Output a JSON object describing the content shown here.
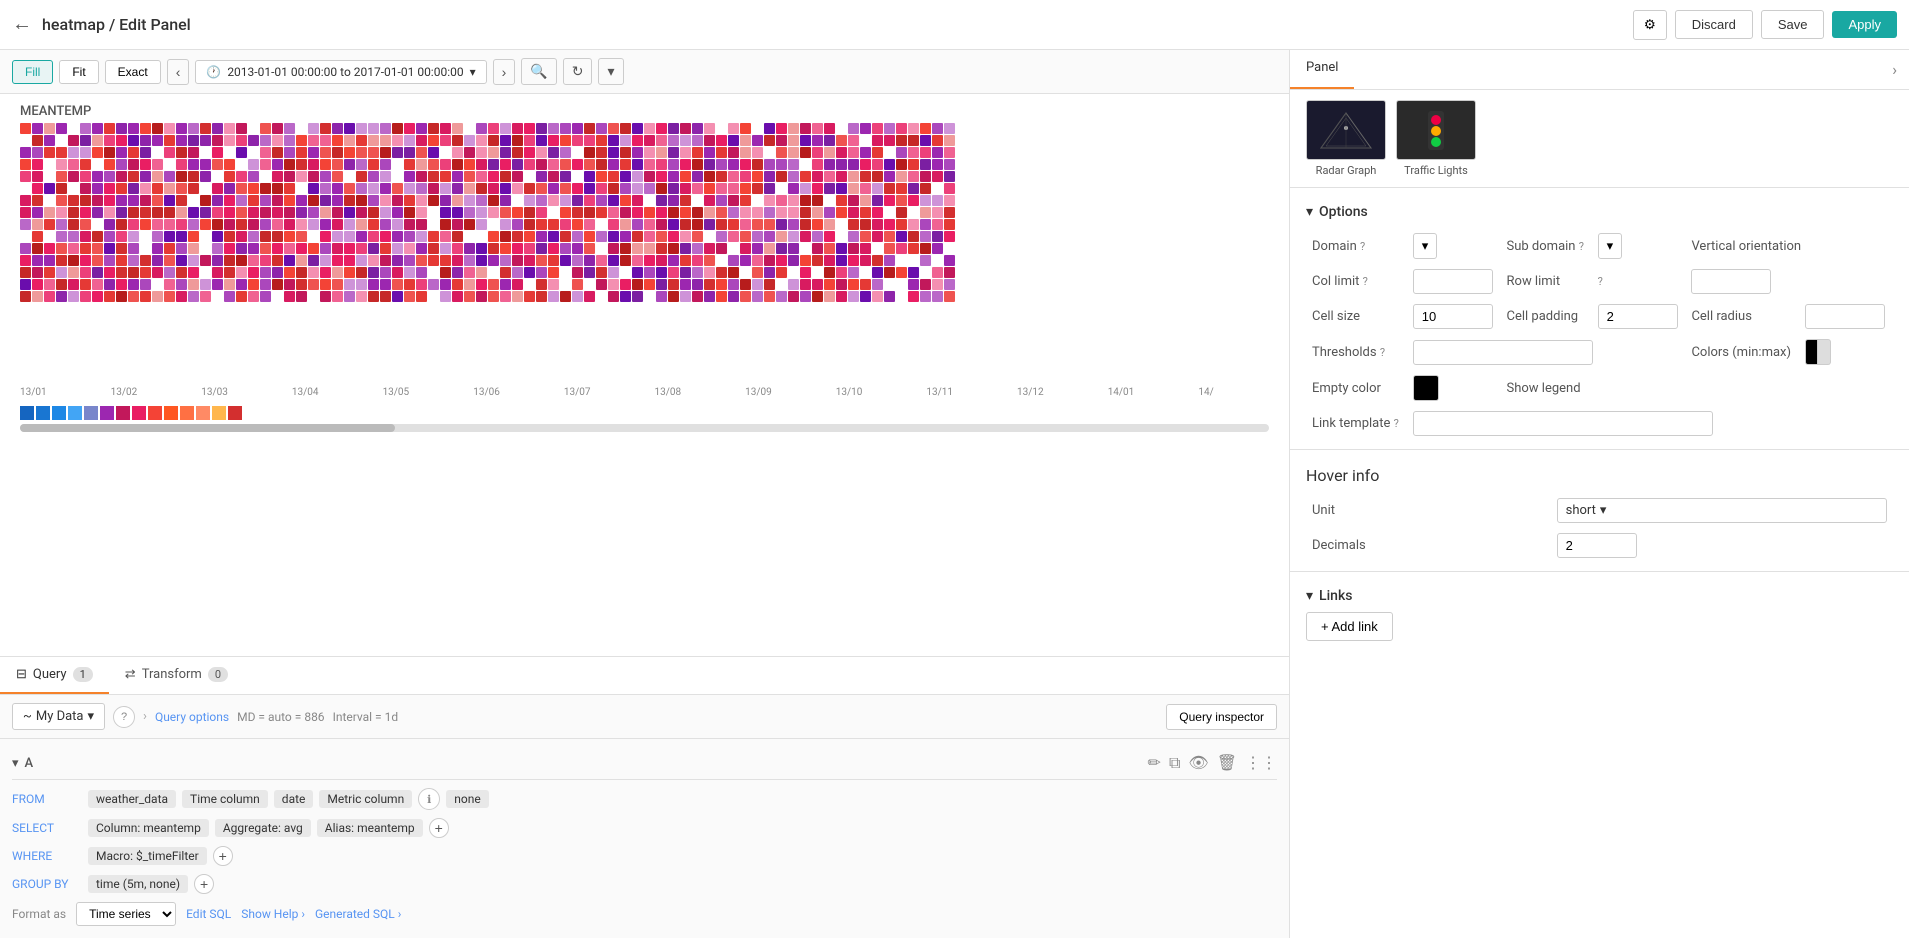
{
  "topbar": {
    "back_icon": "←",
    "title": "heatmap / Edit Panel",
    "settings_icon": "⚙",
    "discard_label": "Discard",
    "save_label": "Save",
    "apply_label": "Apply"
  },
  "viz_toolbar": {
    "fill_label": "Fill",
    "fit_label": "Fit",
    "exact_label": "Exact",
    "prev_icon": "‹",
    "time_icon": "🕐",
    "time_range": "2013-01-01 00:00:00 to 2017-01-01 00:00:00",
    "next_icon": "›",
    "zoom_out_icon": "🔍",
    "refresh_icon": "↻",
    "more_icon": "▾"
  },
  "chart": {
    "title": "MEANTEMP",
    "axis_labels": [
      "13/01",
      "13/02",
      "13/03",
      "13/04",
      "13/05",
      "13/06",
      "13/07",
      "13/08",
      "13/09",
      "13/10",
      "13/11",
      "13/12",
      "14/01",
      "14/"
    ]
  },
  "query_tabs": [
    {
      "label": "Query",
      "badge": "1",
      "icon": "⊟",
      "active": true
    },
    {
      "label": "Transform",
      "badge": "0",
      "icon": "⇄",
      "active": false
    }
  ],
  "query_controls": {
    "datasource": "My Data",
    "datasource_arrow": "▾",
    "query_options_label": "Query options",
    "md_label": "MD = auto = 886",
    "interval_label": "Interval = 1d",
    "inspector_btn_label": "Query inspector"
  },
  "query_section": {
    "section_label": "A",
    "from_label": "FROM",
    "from_value": "weather_data",
    "time_column_label": "Time column",
    "time_column_value": "date",
    "metric_column_label": "Metric column",
    "metric_column_value": "none",
    "select_label": "SELECT",
    "select_column": "Column: meantemp",
    "select_aggregate": "Aggregate: avg",
    "select_alias": "Alias: meantemp",
    "where_label": "WHERE",
    "where_macro": "Macro: $_timeFilter",
    "group_by_label": "GROUP BY",
    "group_by_value": "time (5m, none)",
    "format_label": "Format as",
    "format_value": "Time series",
    "edit_sql_label": "Edit SQL",
    "show_help_label": "Show Help ›",
    "generated_sql_label": "Generated SQL ›"
  },
  "right_panel": {
    "tabs": [
      {
        "label": "Panel",
        "active": true
      }
    ],
    "toggle_icon": "›",
    "viz_thumbnails": [
      {
        "label": "Radar Graph"
      },
      {
        "label": "Traffic Lights"
      }
    ]
  },
  "options": {
    "section_label": "Options",
    "domain_label": "Domain",
    "sub_domain_label": "Sub domain",
    "vertical_orientation_label": "Vertical orientation",
    "col_limit_label": "Col limit",
    "row_limit_label": "Row limit",
    "cell_size_label": "Cell size",
    "cell_size_value": "10",
    "cell_padding_label": "Cell padding",
    "cell_padding_value": "2",
    "cell_radius_label": "Cell radius",
    "thresholds_label": "Thresholds",
    "colors_label": "Colors (min:max)",
    "empty_color_label": "Empty color",
    "show_legend_label": "Show legend",
    "link_template_label": "Link template"
  },
  "hover_info": {
    "title": "Hover info",
    "unit_label": "Unit",
    "unit_value": "short",
    "decimals_label": "Decimals",
    "decimals_value": "2"
  },
  "links": {
    "section_label": "Links",
    "add_link_label": "+ Add link"
  }
}
